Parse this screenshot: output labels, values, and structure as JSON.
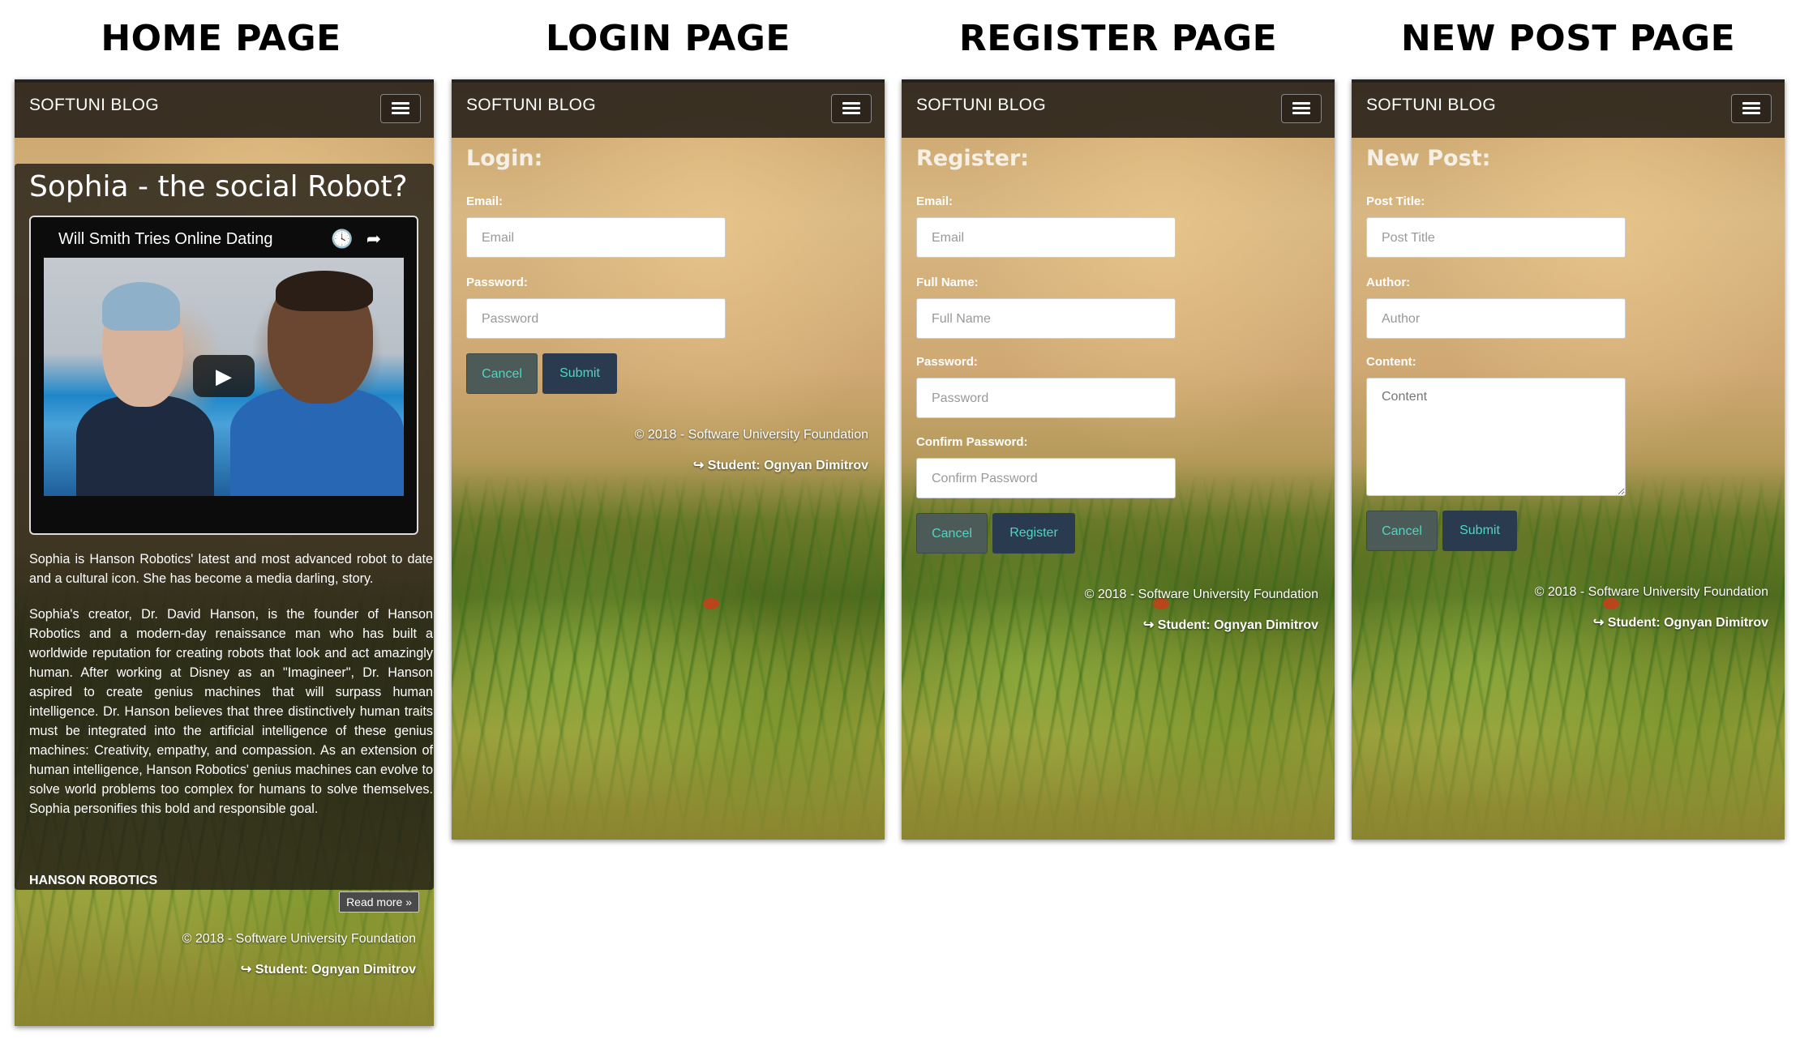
{
  "headings": {
    "home": "HOME PAGE",
    "login": "LOGIN PAGE",
    "register": "REGISTER PAGE",
    "new_post": "NEW POST PAGE"
  },
  "brand": "SOFTUNI BLOG",
  "footer": {
    "copyright": "© 2018 - Software University Foundation",
    "student": "↪ Student: Ognyan Dimitrov"
  },
  "home": {
    "article_title": "Sophia - the social Robot?",
    "video": {
      "title": "Will Smith Tries Online Dating",
      "icons": [
        "clock-icon",
        "share-icon",
        "play-icon"
      ]
    },
    "paragraph_1": "Sophia is Hanson Robotics' latest and most advanced robot to date and a cultural icon. She has become a media darling, story.",
    "paragraph_2": "Sophia's creator, Dr. David Hanson, is the founder of Hanson Robotics and a modern-day renaissance man who has built a worldwide reputation for creating robots that look and act amazingly human. After working at Disney as an \"Imagineer\", Dr. Hanson aspired to create genius machines that will surpass human intelligence. Dr. Hanson believes that three distinctively human traits must be integrated into the artificial intelligence of these genius machines: Creativity, empathy, and compassion. As an extension of human intelligence, Hanson Robotics' genius machines can evolve to solve world problems too complex for humans to solve themselves. Sophia personifies this bold and responsible goal.",
    "author": "HANSON ROBOTICS",
    "read_more": "Read more »"
  },
  "login": {
    "title": "Login:",
    "email_label": "Email:",
    "email_placeholder": "Email",
    "password_label": "Password:",
    "password_placeholder": "Password",
    "cancel": "Cancel",
    "submit": "Submit"
  },
  "register": {
    "title": "Register:",
    "email_label": "Email:",
    "email_placeholder": "Email",
    "fullname_label": "Full Name:",
    "fullname_placeholder": "Full Name",
    "password_label": "Password:",
    "password_placeholder": "Password",
    "confirm_label": "Confirm Password:",
    "confirm_placeholder": "Confirm Password",
    "cancel": "Cancel",
    "submit": "Register"
  },
  "new_post": {
    "title": "New Post:",
    "post_title_label": "Post Title:",
    "post_title_placeholder": "Post Title",
    "author_label": "Author:",
    "author_placeholder": "Author",
    "content_label": "Content:",
    "content_placeholder": "Content",
    "cancel": "Cancel",
    "submit": "Submit"
  },
  "colors": {
    "navbar": "#2d261c",
    "button_text": "#4fd6c2",
    "cancel_bg": "#4c5b57",
    "submit_bg": "#2a3b50"
  }
}
